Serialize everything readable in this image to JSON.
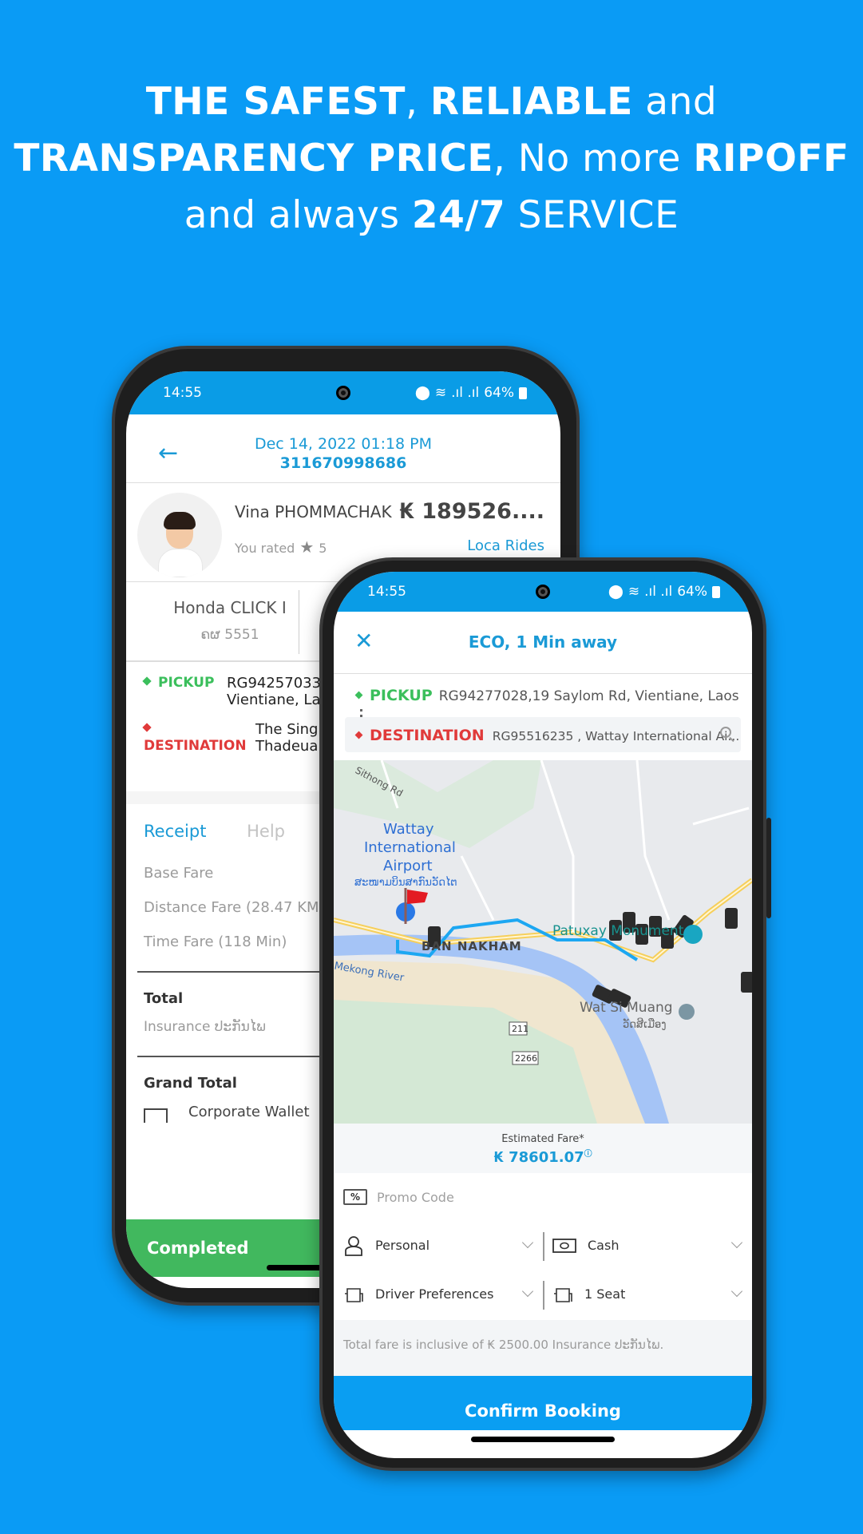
{
  "headline": {
    "line1": [
      {
        "text": "THE SAFEST",
        "bold": true
      },
      {
        "text": ", ",
        "bold": false
      },
      {
        "text": "RELIABLE",
        "bold": true
      },
      {
        "text": " and",
        "bold": false
      }
    ],
    "line2": [
      {
        "text": "TRANSPARENCY PRICE",
        "bold": true
      },
      {
        "text": ", No more ",
        "bold": false
      },
      {
        "text": "RIPOFF",
        "bold": true
      }
    ],
    "line3": [
      {
        "text": "and always ",
        "bold": false
      },
      {
        "text": "24/7",
        "bold": true
      },
      {
        "text": " SERVICE",
        "bold": false
      }
    ]
  },
  "colors": {
    "background": "#0a9bf5",
    "accent": "#1a9ad6",
    "pickup": "#3bbf5c",
    "destination": "#e03a3a",
    "completed": "#41b85e",
    "confirm": "#0a9ef2"
  },
  "status_bar": {
    "time": "14:55",
    "battery": "64%",
    "icons": [
      "location-icon",
      "wifi-icon",
      "signal-icon",
      "signal-icon",
      "battery-icon"
    ]
  },
  "trip_detail": {
    "date": "Dec 14, 2022 01:18 PM",
    "trip_id": "311670998686",
    "driver": {
      "name": "Vina  PHOMMACHAK",
      "rated_label": "You rated",
      "rating": "5"
    },
    "fare": "₭ 189526....",
    "company": "Loca Rides",
    "vehicle": {
      "model": "Honda CLICK I",
      "plate": "ຄຜ 5551"
    },
    "pickup": {
      "label": "PICKUP",
      "line1": "RG94257033",
      "line2": "Vientiane, La"
    },
    "destination": {
      "label": "DESTINATION",
      "line1": "The Sing",
      "line2": "Thadeua"
    },
    "tabs": [
      {
        "label": "Receipt",
        "active": true
      },
      {
        "label": "Help",
        "active": false
      }
    ],
    "fare_lines": [
      "Base Fare",
      "Distance Fare (28.47 KM)",
      "Time Fare (118 Min)"
    ],
    "total_label": "Total",
    "insurance_label": "Insurance ປະກັນໄພ",
    "grand_total_label": "Grand Total",
    "payment": "Corporate Wallet",
    "status": "Completed"
  },
  "booking": {
    "eta": "ECO, 1 Min away",
    "pickup": {
      "label": "PICKUP",
      "address": "RG94277028,19 Saylom Rd, Vientiane, Laos"
    },
    "destination": {
      "label": "DESTINATION",
      "address": "RG95516235 , Wattay International Ai..."
    },
    "map": {
      "labels": {
        "road": "Sithong Rd",
        "airport1": "Wattay",
        "airport2": "International",
        "airport3": "Airport",
        "airport_lao": "ສະໜາມບິນສາກົນວັດໄຕ",
        "district": "BAN NAKHAM",
        "monument": "Patuxay Monument",
        "river": "Mekong River",
        "temple": "Wat Si Muang",
        "temple_lao": "ວັດສີເມືອງ",
        "route1": "211",
        "route2": "2266"
      }
    },
    "estimated_fare_label": "Estimated Fare*",
    "estimated_fare": "₭ 78601.07",
    "promo_placeholder": "Promo Code",
    "options": {
      "profile": "Personal",
      "payment": "Cash",
      "preferences": "Driver Preferences",
      "seats": "1 Seat"
    },
    "insurance_note": "Total fare is inclusive of ₭ 2500.00 Insurance ປະກັນໄພ.",
    "confirm_label": "Confirm Booking"
  }
}
